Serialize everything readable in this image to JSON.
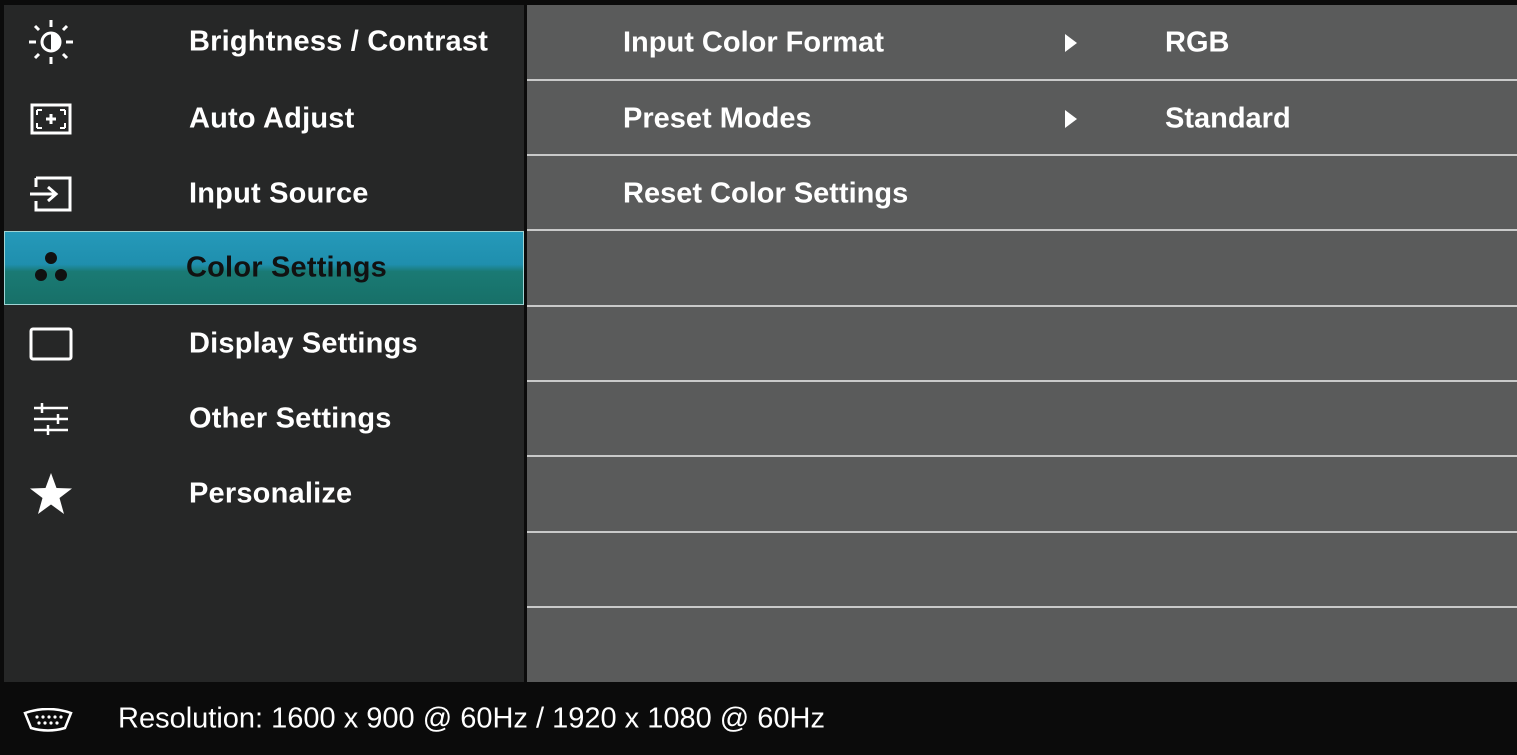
{
  "menu": {
    "items": [
      {
        "label": "Brightness / Contrast",
        "icon": "brightness-icon"
      },
      {
        "label": "Auto Adjust",
        "icon": "auto-adjust-icon"
      },
      {
        "label": "Input Source",
        "icon": "input-source-icon"
      },
      {
        "label": "Color Settings",
        "icon": "color-settings-icon",
        "selected": true
      },
      {
        "label": "Display Settings",
        "icon": "display-settings-icon"
      },
      {
        "label": "Other Settings",
        "icon": "other-settings-icon"
      },
      {
        "label": "Personalize",
        "icon": "star-icon"
      }
    ],
    "selected_color": "#1f8fae"
  },
  "submenu": {
    "rows": [
      {
        "label": "Input Color Format",
        "value": "RGB"
      },
      {
        "label": "Preset Modes",
        "value": "Standard"
      },
      {
        "label": "Reset Color Settings",
        "value": ""
      }
    ]
  },
  "status": {
    "icon": "vga-connector-icon",
    "resolution": "Resolution:  1600 x 900 @ 60Hz / 1920 x 1080 @ 60Hz"
  }
}
